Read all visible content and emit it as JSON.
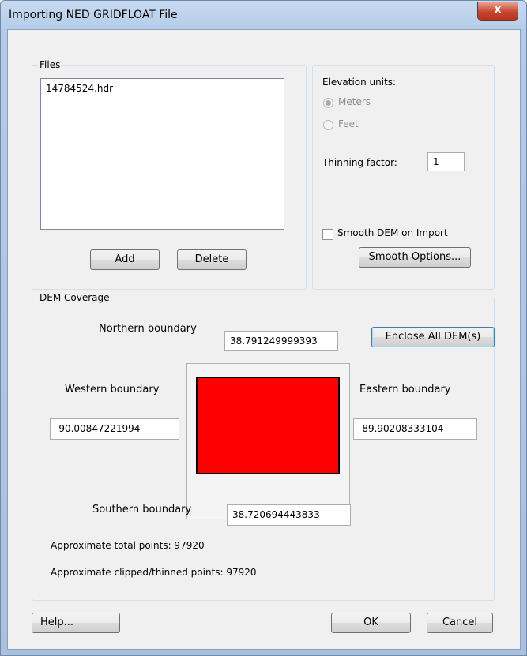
{
  "window": {
    "title": "Importing NED GRIDFLOAT File",
    "close_glyph": "X"
  },
  "files": {
    "label": "Files",
    "items": [
      "14784524.hdr"
    ],
    "add_label": "Add",
    "delete_label": "Delete"
  },
  "options": {
    "elevation_units_label": "Elevation units:",
    "meters_label": "Meters",
    "feet_label": "Feet",
    "selected_unit": "Meters",
    "units_enabled": false,
    "thinning_label": "Thinning factor:",
    "thinning_value": "1",
    "smooth_label": "Smooth DEM on Import",
    "smooth_checked": false,
    "smooth_options_label": "Smooth Options..."
  },
  "coverage": {
    "label": "DEM Coverage",
    "north_label": "Northern boundary",
    "north_value": "38.791249999393",
    "enclose_label": "Enclose All DEM(s)",
    "west_label": "Western boundary",
    "west_value": "-90.00847221994",
    "east_label": "Eastern boundary",
    "east_value": "-89.90208333104",
    "south_label": "Southern boundary",
    "south_value": "38.720694443833",
    "coverage_color": "#ff0000",
    "total_points": "Approximate total points: 97920",
    "clipped_points": "Approximate clipped/thinned points: 97920"
  },
  "footer": {
    "help_label": "Help...",
    "ok_label": "OK",
    "cancel_label": "Cancel"
  }
}
